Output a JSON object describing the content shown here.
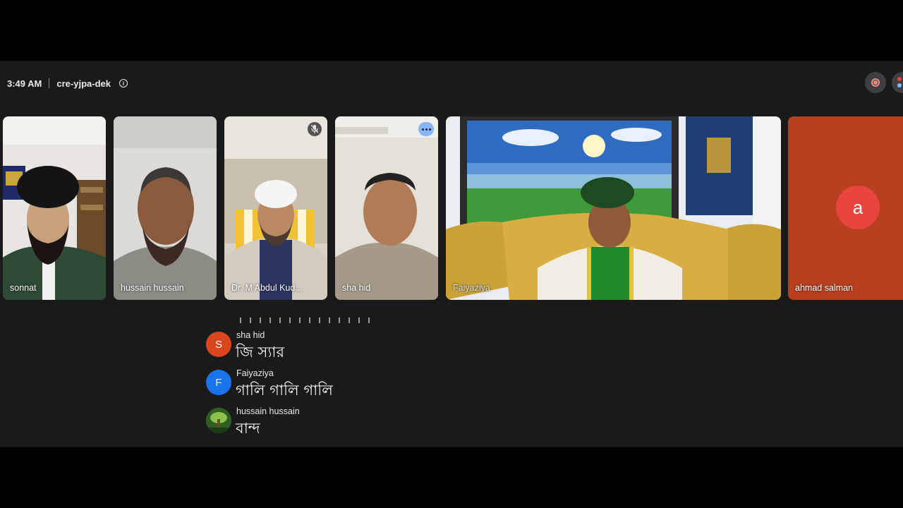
{
  "header": {
    "time": "3:49 AM",
    "meeting_code": "cre-yjpa-dek",
    "info_icon": "info-icon",
    "record_icon": "recording-icon"
  },
  "participants": [
    {
      "name": "sonnat",
      "icon": "video-feed"
    },
    {
      "name": "hussain hussain",
      "icon": "video-feed"
    },
    {
      "name": "Dr. M Abdul Kud...",
      "icon": "mic-off-icon"
    },
    {
      "name": "sha hid",
      "icon": "more-options-icon"
    },
    {
      "name": "Faiyaziya",
      "icon": "video-feed"
    },
    {
      "name": "ahmad salman",
      "avatar_letter": "a",
      "avatar_color": "#e8453c"
    }
  ],
  "captions": [
    {
      "sender": "sha hid",
      "avatar_letter": "S",
      "avatar_color": "#e8453c",
      "text": "জি স্যার"
    },
    {
      "sender": "Faiyaziya",
      "avatar_letter": "F",
      "avatar_color": "#1a73e8",
      "text": "গালি গালি গালি"
    },
    {
      "sender": "hussain hussain",
      "avatar_letter": "",
      "avatar_color": "#3a7a2a",
      "text": "বান্দ"
    }
  ],
  "colors": {
    "background": "#1a1a1a",
    "active_speaker_border": "#8ab4f8",
    "tile_bg": "#3c4043"
  }
}
